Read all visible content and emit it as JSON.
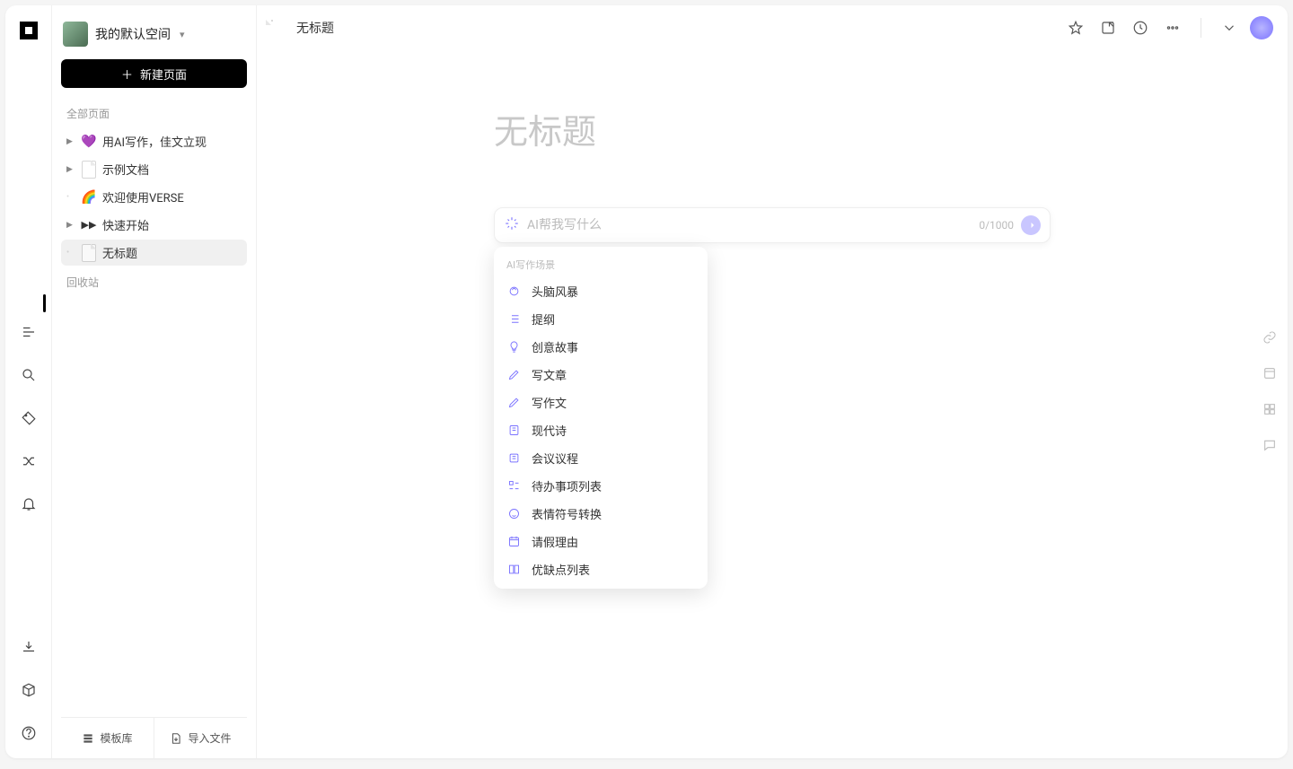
{
  "workspace": {
    "name": "我的默认空间"
  },
  "sidebar": {
    "new_page": "新建页面",
    "all_pages": "全部页面",
    "items": [
      {
        "emoji": "💜",
        "label": "用AI写作，佳文立现"
      },
      {
        "emoji": "page",
        "label": "示例文档"
      },
      {
        "emoji": "🌈",
        "label": "欢迎使用VERSE"
      },
      {
        "emoji": "ff",
        "label": "快速开始"
      },
      {
        "emoji": "page",
        "label": "无标题"
      }
    ],
    "trash": "回收站",
    "footer": {
      "templates": "模板库",
      "import": "导入文件"
    }
  },
  "topbar": {
    "title": "无标题"
  },
  "document": {
    "title_placeholder": "无标题"
  },
  "ai": {
    "placeholder": "AI帮我写什么",
    "count": "0",
    "max": "/1000",
    "menu_header": "AI写作场景",
    "menu": [
      {
        "label": "头脑风暴"
      },
      {
        "label": "提纲"
      },
      {
        "label": "创意故事"
      },
      {
        "label": "写文章"
      },
      {
        "label": "写作文"
      },
      {
        "label": "现代诗"
      },
      {
        "label": "会议议程"
      },
      {
        "label": "待办事项列表"
      },
      {
        "label": "表情符号转换"
      },
      {
        "label": "请假理由"
      },
      {
        "label": "优缺点列表"
      }
    ]
  }
}
